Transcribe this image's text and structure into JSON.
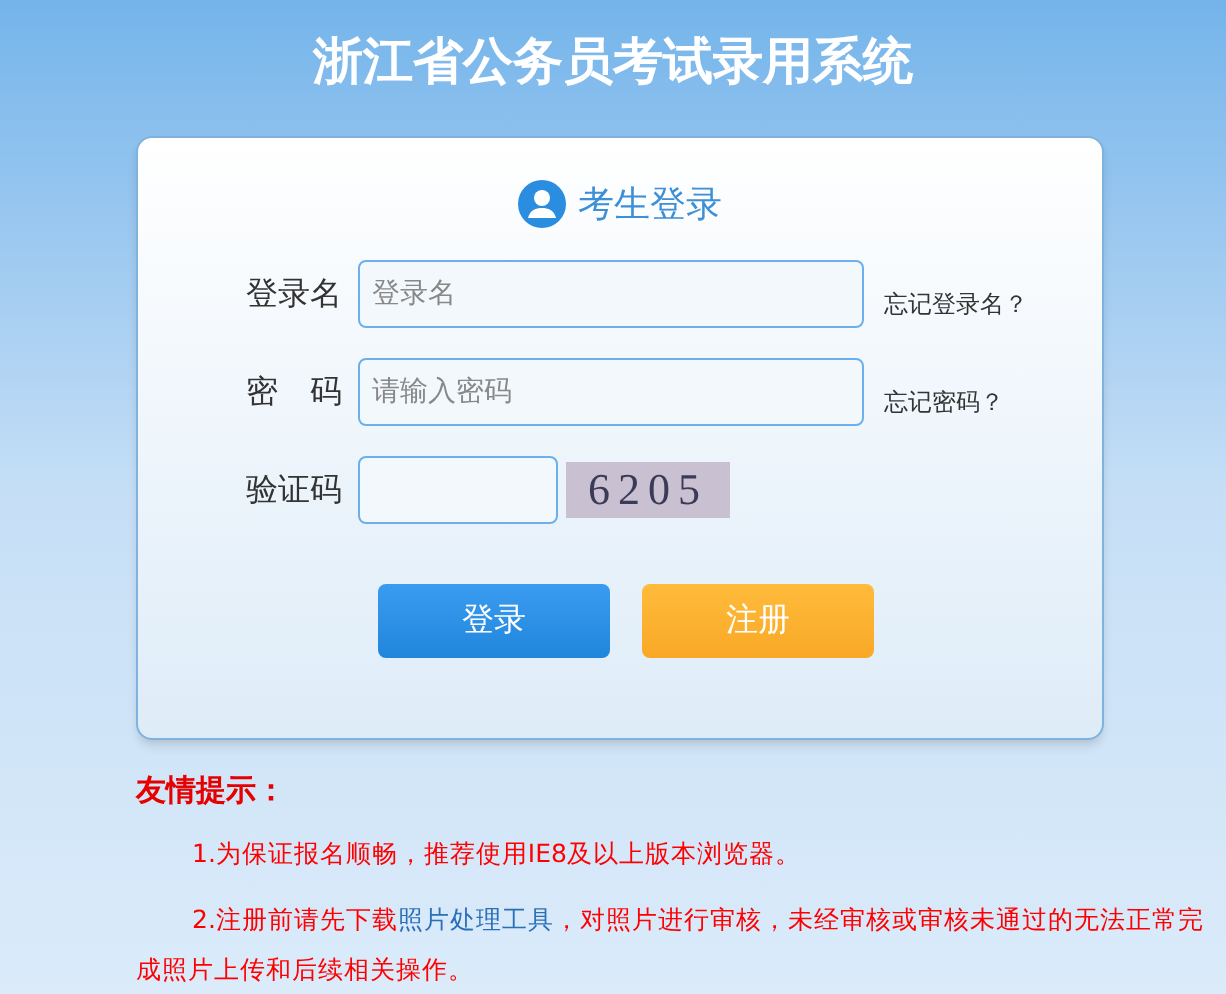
{
  "title": "浙江省公务员考试录用系统",
  "login": {
    "heading": "考生登录",
    "fields": [
      {
        "kind": "text",
        "label": "登录名",
        "placeholder": "登录名",
        "link": "忘记登录名？"
      },
      {
        "kind": "password",
        "label": "密　码",
        "placeholder": "请输入密码",
        "link": "忘记密码？"
      },
      {
        "kind": "captcha",
        "label": "验证码",
        "captcha": "6205"
      }
    ],
    "buttons": [
      {
        "kind": "primary",
        "label": "登录"
      },
      {
        "kind": "secondary",
        "label": "注册"
      }
    ]
  },
  "notice": {
    "title": "友情提示：",
    "items": [
      {
        "before": "1.为保证报名顺畅，推荐使用IE8及以上版本浏览器。"
      },
      {
        "before": "2.注册前请先下载",
        "link": "照片处理工具",
        "after": "，对照片进行审核，未经审核或审核未通过的无法正常完成照片上传和后续相关操作。"
      }
    ]
  }
}
